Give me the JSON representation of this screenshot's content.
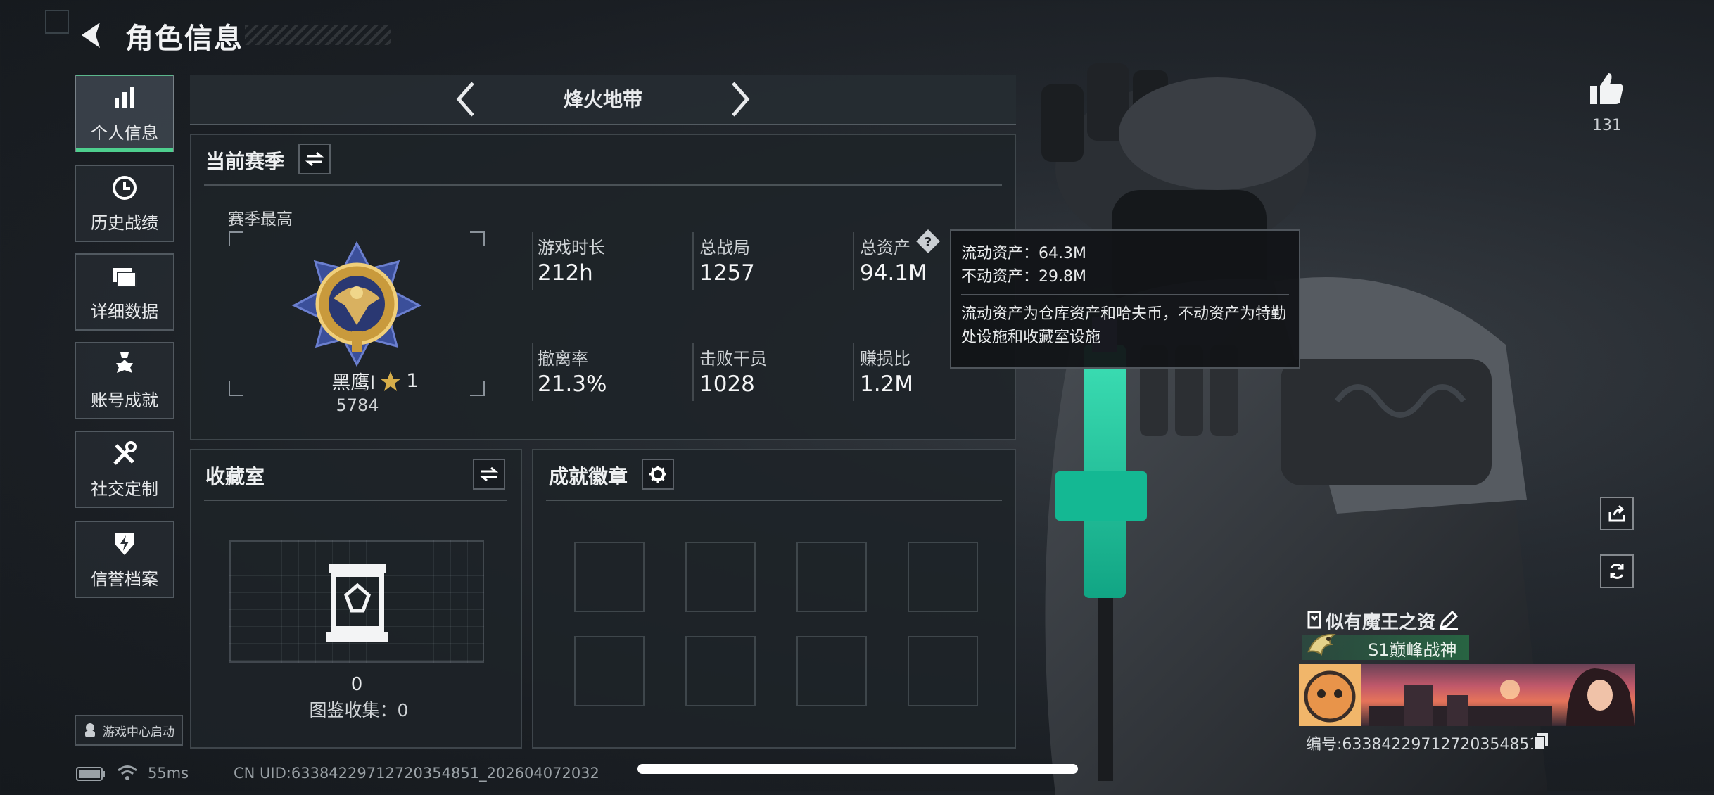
{
  "header": {
    "title": "角色信息"
  },
  "sidebar": {
    "items": [
      {
        "label": "个人信息",
        "icon": "bar-chart-icon",
        "active": true
      },
      {
        "label": "历史战绩",
        "icon": "history-clock-icon"
      },
      {
        "label": "详细数据",
        "icon": "folder-icon"
      },
      {
        "label": "账号成就",
        "icon": "achievement-medal-icon"
      },
      {
        "label": "社交定制",
        "icon": "tools-icon"
      },
      {
        "label": "信誉档案",
        "icon": "reputation-badge-icon"
      }
    ],
    "launch": "游戏中心启动"
  },
  "mode": {
    "title": "烽火地带"
  },
  "season": {
    "title": "当前赛季",
    "best_label": "赛季最高",
    "rank_name": "黑鹰I",
    "rank_stars": "1",
    "rank_score": "5784",
    "stats": [
      {
        "label": "游戏时长",
        "value": "212h"
      },
      {
        "label": "总战局",
        "value": "1257"
      },
      {
        "label": "总资产",
        "value": "94.1M"
      },
      {
        "label": "撤离率",
        "value": "21.3%"
      },
      {
        "label": "击败干员",
        "value": "1028"
      },
      {
        "label": "赚损比",
        "value": "1.2M"
      }
    ]
  },
  "tooltip": {
    "liquid": "流动资产：64.3M",
    "fixed": "不动资产：29.8M",
    "desc": "流动资产为仓库资产和哈夫币，不动资产为特勤处设施和收藏室设施"
  },
  "collection": {
    "title": "收藏室",
    "count": "0",
    "catalog": "图鉴收集：0"
  },
  "achievements": {
    "title": "成就徽章"
  },
  "likes": {
    "count": "131"
  },
  "player": {
    "name": "似有魔王之资",
    "title_badge": "S1巅峰战神",
    "id_label": "编号:63384229712720354851"
  },
  "status": {
    "ping": "55ms",
    "uid": "CN UID:63384229712720354851_202604072032"
  },
  "colors": {
    "accent": "#4ecf8e",
    "rank_gold": "#c99a3c",
    "rank_blue": "#3b4f9a"
  }
}
